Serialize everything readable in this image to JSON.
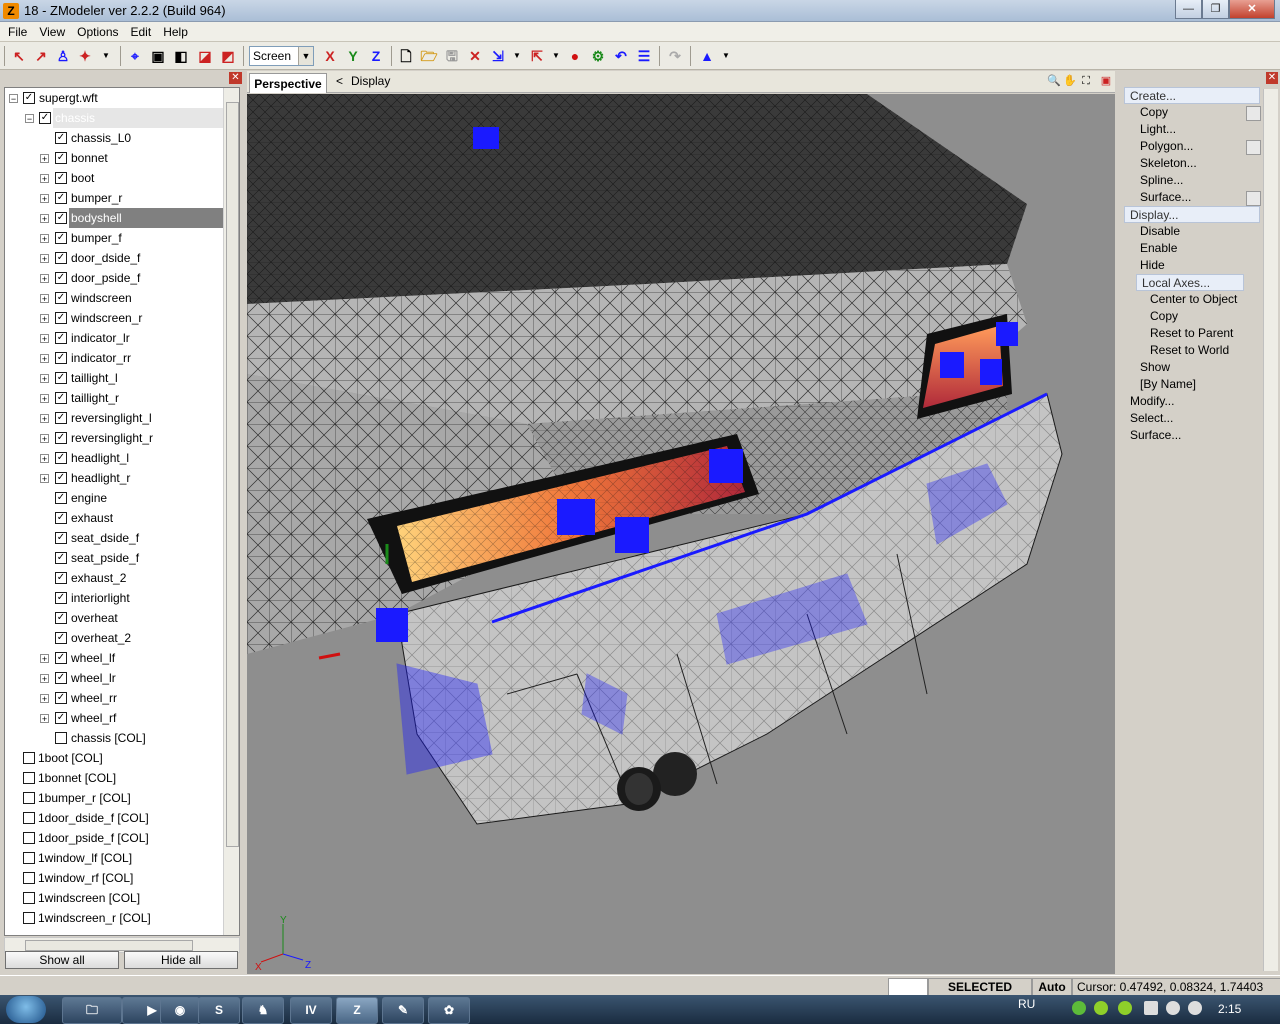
{
  "window": {
    "title": "18 - ZModeler ver 2.2.2 (Build 964)",
    "app_icon": "Z",
    "minimize": "—",
    "maximize": "❐",
    "close": "✕"
  },
  "menu": [
    "File",
    "View",
    "Options",
    "Edit",
    "Help"
  ],
  "toolbar": {
    "coord_select": "Screen",
    "axis_x": "X",
    "axis_y": "Y",
    "axis_z": "Z"
  },
  "tree": {
    "root": "supergt.wft",
    "chassis": "chassis",
    "children": [
      "chassis_L0",
      "bonnet",
      "boot",
      "bumper_r",
      "bodyshell",
      "bumper_f",
      "door_dside_f",
      "door_pside_f",
      "windscreen",
      "windscreen_r",
      "indicator_lr",
      "indicator_rr",
      "taillight_l",
      "taillight_r",
      "reversinglight_l",
      "reversinglight_r",
      "headlight_l",
      "headlight_r",
      "engine",
      "exhaust",
      "seat_dside_f",
      "seat_pside_f",
      "exhaust_2",
      "interiorlight",
      "overheat",
      "overheat_2",
      "wheel_lf",
      "wheel_lr",
      "wheel_rr",
      "wheel_rf",
      "chassis [COL]"
    ],
    "collisions": [
      "1boot [COL]",
      "1bonnet [COL]",
      "1bumper_r [COL]",
      "1door_dside_f [COL]",
      "1door_pside_f [COL]",
      "1window_lf [COL]",
      "1window_rf [COL]",
      "1windscreen [COL]",
      "1windscreen_r [COL]"
    ]
  },
  "buttons": {
    "show_all": "Show all",
    "hide_all": "Hide all"
  },
  "viewport": {
    "tab": "Perspective",
    "breadcrumb_arrow": "<",
    "breadcrumb": "Display",
    "axis_y": "Y",
    "axis_x": "X",
    "axis_z": "Z"
  },
  "commands": {
    "create": "Create...",
    "copy": "Copy",
    "light": "Light...",
    "polygon": "Polygon...",
    "skeleton": "Skeleton...",
    "spline": "Spline...",
    "surface": "Surface...",
    "display": "Display...",
    "disable": "Disable",
    "enable": "Enable",
    "hide": "Hide",
    "local_axes": "Local Axes...",
    "center_to_object": "Center to Object",
    "copy2": "Copy",
    "reset_to_parent": "Reset to Parent",
    "reset_to_world": "Reset to World",
    "show": "Show",
    "by_name": "[By Name]",
    "modify": "Modify...",
    "select": "Select...",
    "surface2": "Surface..."
  },
  "status": {
    "mode": "SELECTED MODE",
    "auto": "Auto",
    "cursor": "Cursor: 0.47492, 0.08324, 1.74403"
  },
  "taskbar": {
    "lang": "RU",
    "clock": "2:15",
    "active_task": "Z"
  },
  "colors": {
    "accent_blue": "#1a1aff",
    "title_bar": "#aabed6",
    "viewport_bg": "#8e8e8e"
  }
}
